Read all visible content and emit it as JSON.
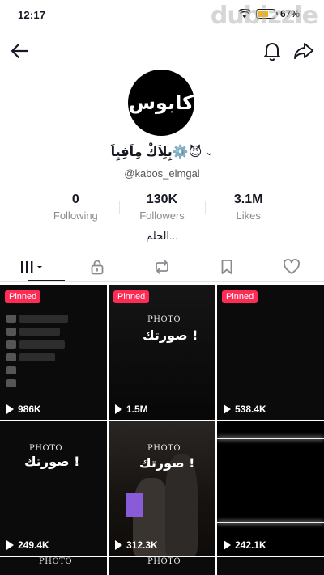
{
  "status_bar": {
    "time": "12:17",
    "battery": "67%",
    "battery_level": 0.67,
    "watermark": "dubizzle"
  },
  "profile": {
    "avatar_text": "كابوس",
    "display_name": "بِلِاَكْ مِاَفِيِاَ⚙️😈",
    "handle": "@kabos_elmgal",
    "bio": "الحلم..."
  },
  "stats": [
    {
      "value": "0",
      "label": "Following"
    },
    {
      "value": "130K",
      "label": "Followers"
    },
    {
      "value": "3.1M",
      "label": "Likes"
    }
  ],
  "tabs": [
    {
      "icon": "videos-grid-icon"
    },
    {
      "icon": "lock-icon"
    },
    {
      "icon": "repost-icon"
    },
    {
      "icon": "bookmark-icon"
    },
    {
      "icon": "heart-icon"
    }
  ],
  "videos": [
    {
      "pinned_label": "Pinned",
      "views": "986K"
    },
    {
      "pinned_label": "Pinned",
      "views": "1.5M",
      "overlay_top": "PHOTO",
      "overlay_text": "صورتك !"
    },
    {
      "pinned_label": "Pinned",
      "views": "538.4K"
    },
    {
      "views": "249.4K",
      "overlay_top": "PHOTO",
      "overlay_text": "صورتك !"
    },
    {
      "views": "312.3K",
      "overlay_top": "PHOTO",
      "overlay_text": "صورتك !"
    },
    {
      "views": "242.1K"
    }
  ],
  "partial_row": [
    {
      "overlay_top": "PHOTO"
    },
    {
      "overlay_top": "PHOTO"
    },
    {}
  ],
  "colors": {
    "pinned_badge": "#fe2c55",
    "text_primary": "#161823",
    "text_secondary": "#8a8b91"
  }
}
